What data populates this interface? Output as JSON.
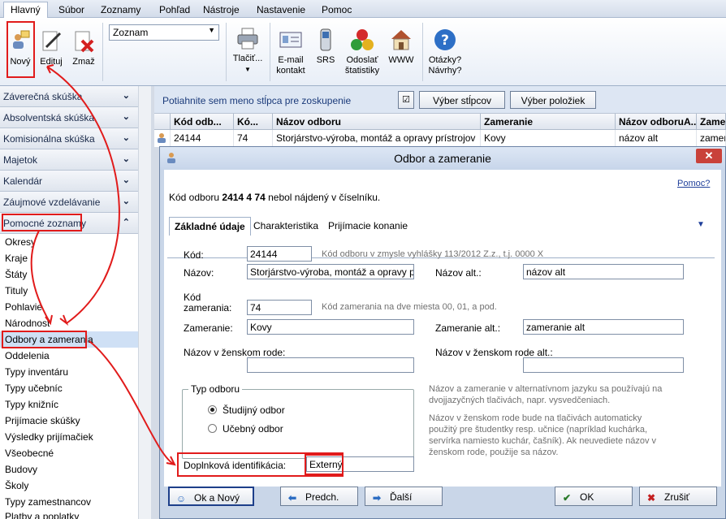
{
  "menu": {
    "tabs": [
      "Hlavný",
      "Súbor",
      "Zoznamy",
      "Pohľad",
      "Nástroje",
      "Nastavenie",
      "Pomoc"
    ]
  },
  "ribbon": {
    "novy": "Nový",
    "edituj": "Edituj",
    "zmaz": "Zmaž",
    "zoznam_value": "Zoznam",
    "tlacit": "Tlačiť...",
    "email_1": "E-mail",
    "email_2": "kontakt",
    "srs": "SRS",
    "odoslat_1": "Odoslať",
    "odoslat_2": "štatistiky",
    "www": "WWW",
    "otazky_1": "Otázky?",
    "otazky_2": "Návrhy?"
  },
  "sidebar": {
    "categories": [
      "Záverečná skúška",
      "Absolventská skúška",
      "Komisionálna skúška",
      "Majetok",
      "Kalendár",
      "Záujmové vzdelávanie",
      "Pomocné zoznamy"
    ],
    "items": [
      "Okresy",
      "Kraje",
      "Štáty",
      "Tituly",
      "Pohlavie",
      "Národnosť",
      "Odbory a zamerania",
      "Oddelenia",
      "Typy inventáru",
      "Typy učebníc",
      "Typy knižníc",
      "Prijímacie skúšky",
      "Výsledky prijímačiek",
      "Všeobecné",
      "Budovy",
      "Školy",
      "Typy zamestnancov",
      "Platby a poplatky"
    ]
  },
  "grid": {
    "group_hint": "Potiahnite sem meno stĺpca pre zoskupenie",
    "btn_columns": "Výber stĺpcov",
    "btn_items": "Výber položiek",
    "headers": [
      "Kód odb...",
      "Kó...",
      "Názov odboru",
      "Zameranie",
      "Názov odboruA...",
      "Zame"
    ],
    "row": [
      "24144",
      "74",
      "Storjárstvo-výroba, montáž a opravy prístrojov",
      "Kovy",
      "názov alt",
      "zamer"
    ]
  },
  "dialog": {
    "title": "Odbor a zameranie",
    "help": "Pomoc?",
    "not_found_pre": "Kód odboru ",
    "not_found_code": "2414 4 74",
    "not_found_post": " nebol nájdený v číselníku.",
    "tabs": [
      "Základné údaje",
      "Charakteristika",
      "Prijímacie konanie"
    ],
    "kod_label": "Kód:",
    "kod_value": "24144",
    "kod_hint": "Kód odboru v zmysle vyhlášky 113/2012 Z.z., t.j. 0000 X",
    "nazov_label": "Názov:",
    "nazov_value": "Storjárstvo-výroba, montáž a opravy prístro",
    "nazov_alt_label": "Názov alt.:",
    "nazov_alt_value": "názov alt",
    "kod_zam_label_1": "Kód",
    "kod_zam_label_2": "zamerania:",
    "kod_zam_value": "74",
    "kod_zam_hint": "Kód zamerania na dve miesta 00, 01, a pod.",
    "zam_label": "Zameranie:",
    "zam_value": "Kovy",
    "zam_alt_label": "Zameranie alt.:",
    "zam_alt_value": "zameranie alt",
    "zensky_label": "Názov v ženskom rode:",
    "zensky_alt_label": "Názov v ženskom rode alt.:",
    "typ_odboru": "Typ odboru",
    "studijny": "Študijný odbor",
    "ucebny": "Učebný odbor",
    "hint_alt": "Názov a zameranie v alternatívnom jazyku sa používajú na dvojjazyčných tlačivách, napr. vysvedčeniach.",
    "hint_zensky": "Názov v ženskom rode bude na tlačivách automaticky použitý pre študentky resp. učnice (napríklad kuchárka, servírka namiesto kuchár, čašník). Ak neuvediete názov v ženskom rode, použije sa názov.",
    "dopl_label": "Doplnková identifikácia:",
    "dopl_value": "Externý",
    "btn_ok_novy": "Ok a Nový",
    "btn_predch": "Predch.",
    "btn_dalsi": "Ďalší",
    "btn_ok": "OK",
    "btn_zrusit": "Zrušiť"
  }
}
